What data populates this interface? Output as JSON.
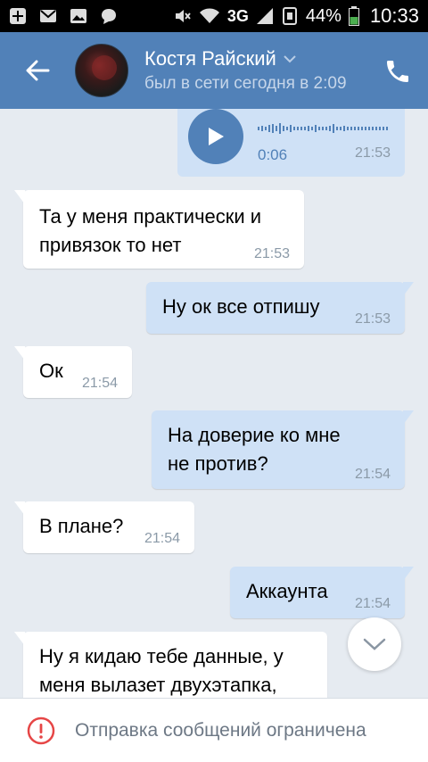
{
  "status_bar": {
    "battery": "44%",
    "time": "10:33",
    "network": "3G"
  },
  "header": {
    "contact_name": "Костя Райский",
    "last_seen": "был в сети сегодня в 2:09"
  },
  "voice_message": {
    "duration": "0:06",
    "time": "21:53"
  },
  "messages": [
    {
      "direction": "in",
      "text": "Та у меня практически и привязок то нет",
      "time": "21:53"
    },
    {
      "direction": "out",
      "text": "Ну ок все отпишу",
      "time": "21:53"
    },
    {
      "direction": "in",
      "text": "Ок",
      "time": "21:54"
    },
    {
      "direction": "out",
      "text": "На доверие ко мне не против?",
      "time": "21:54"
    },
    {
      "direction": "in",
      "text": "В плане?",
      "time": "21:54"
    },
    {
      "direction": "out",
      "text": "Аккаунта",
      "time": "21:54"
    },
    {
      "direction": "in",
      "text": "Ну я кидаю тебе данные, у меня вылазет двухэтапка,",
      "time": ""
    }
  ],
  "bottom_bar": {
    "notice": "Отправка сообщений ограничена"
  },
  "colors": {
    "header": "#5181b8",
    "outgoing_bubble": "#cfe1f6",
    "incoming_bubble": "#ffffff",
    "background": "#e6ebf1",
    "warning": "#e64646"
  }
}
